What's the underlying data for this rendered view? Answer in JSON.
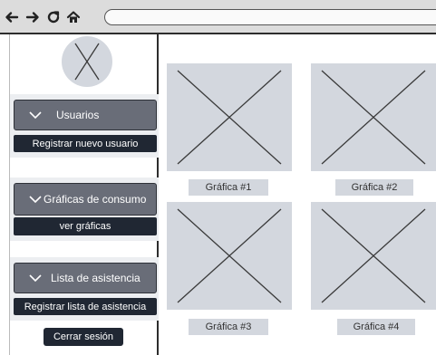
{
  "browser": {
    "icons": [
      "back-arrow-icon",
      "forward-arrow-icon",
      "reload-icon",
      "home-icon"
    ],
    "address": ""
  },
  "sidebar": {
    "avatar_icon": "placeholder-image-icon",
    "groups": [
      {
        "header": "Usuarios",
        "action": "Registrar nuevo usuario"
      },
      {
        "header": "Gráficas de consumo",
        "action": "ver gráficas"
      },
      {
        "header": "Lista de asistencia",
        "action": "Registrar lista de asistencia"
      }
    ],
    "logout": "Cerrar sesión"
  },
  "charts": [
    {
      "label": "Gráfica  #1"
    },
    {
      "label": "Gráfica #2"
    },
    {
      "label": "Gráfica #3"
    },
    {
      "label": "Gráfica #4"
    }
  ],
  "colors": {
    "toolbar": "#dcdcdc",
    "menu_header": "#696d78",
    "menu_action": "#202733",
    "placeholder": "#d3d7de"
  }
}
